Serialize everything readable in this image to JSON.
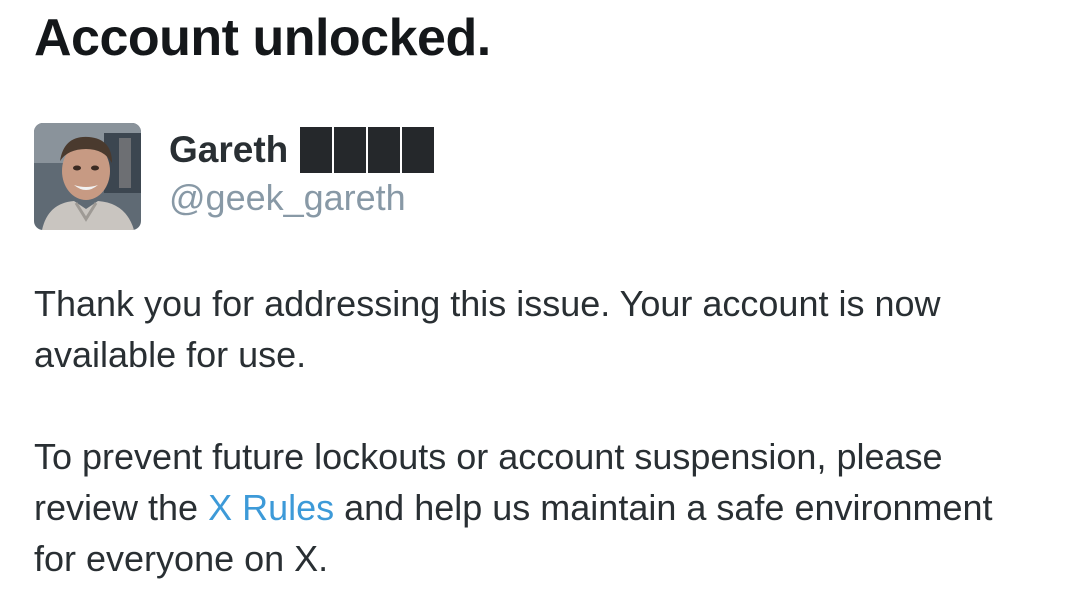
{
  "headline": "Account unlocked.",
  "user": {
    "display_name": "Gareth",
    "handle": "@geek_gareth",
    "redacted_blocks": 4
  },
  "message": {
    "para1": "Thank you for addressing this issue. Your account is now available for use.",
    "para2_before": "To prevent future lockouts or account suspension, please review the ",
    "para2_link": "X Rules",
    "para2_after": " and help us maintain a safe environment for everyone on X."
  },
  "colors": {
    "link": "#3d9ad8",
    "handle": "#8899a6",
    "text": "#292f33",
    "redaction": "#25282b"
  }
}
